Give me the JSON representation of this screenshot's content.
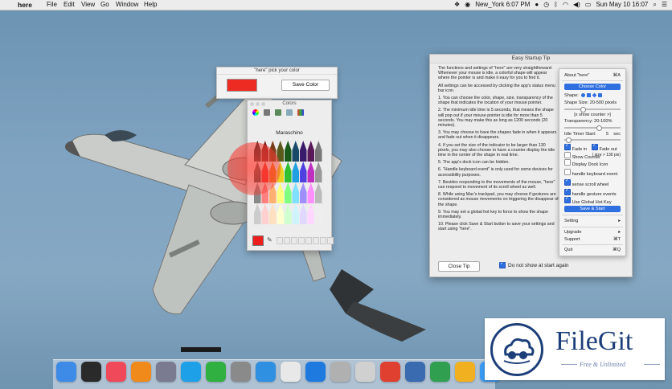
{
  "menubar": {
    "app_name": "here",
    "menus": [
      "File",
      "Edit",
      "View",
      "Go",
      "Window",
      "Help"
    ],
    "status": {
      "location_time": "New_York 6:07 PM",
      "datetime": "Sun May 10  16:07"
    }
  },
  "pick_window": {
    "title": "\"here\" pick your color",
    "save_label": "Save Color",
    "color": "#ee2b22"
  },
  "colors_panel": {
    "title": "Colors",
    "color_name": "Maraschino"
  },
  "tip_window": {
    "title": "Easy Startup Tip",
    "paragraphs": [
      "The functions and settings of \"here\" are very straightforward: Whenever your mouse is idle, a colorful shape will appear where the pointer is and make it easy for you to find it.",
      "All settings can be accessed by clicking the app's status menu bar icon.",
      "1.   You can choose the color, shape, size, transparency of the shape that indicates the location of your mouse pointer.",
      "2.   The minimum idle time is 5 seconds, that means the shape will pop out if your mouse pointer is idle for more than 5 seconds. You may make this as long as 1200 seconds (20 minutes).",
      "3.   You may choose to have the shapes fade in when it appears and fade out when it disappears.",
      "4.   If you set the size of the indicator to be larger than 130 pixels, you may also choose to have a counter display the idle time in the center of the shape in real time.",
      "5.   The app's dock icon can be hidden.",
      "6.   \"Handle keyboard event\" is only used for some devices for accessibility purposes.",
      "7.   Besides responding to the movements of the mouse, \"here\" can respond to movement of its scroll wheel as well.",
      "8.   While using Mac's trackpad, you may choose if gestures are considered as mouse movements on triggering the disappear of the shape.",
      "9.   You may set a global hot key to force to show the shape immediately.",
      "10.  Please click Save & Start button to save your settings and start using \"here\"."
    ],
    "close_label": "Close Tip",
    "dont_show_label": "Do not show at start again"
  },
  "status_menu": {
    "about_label": "About \"here\"",
    "about_shortcut": "⌘A",
    "choose_color_label": "Choose Color",
    "shape_label": "Shape:",
    "shape_size_label": "Shape Size: 20-500 pixels",
    "show_counter_hint": "[x show counter >]",
    "transparency_label": "Transparency: 20-100%",
    "idle_timer_label": "Idle Timer Start:",
    "idle_timer_value": "5",
    "idle_timer_unit": "sec",
    "fade_in_label": "Fade in",
    "fade_out_label": "Fade out",
    "show_counter_label": "Show Counter",
    "show_counter_note": "( size > 130 pix)",
    "dock_icon_label": "Display Dock Icon",
    "keyboard_label": "handle keyboard event",
    "scroll_label": "sense scroll wheel",
    "gesture_label": "handle gesture events",
    "hotkey_label": "Use Global Hot Key",
    "save_start_label": "Save & Start",
    "setting_label": "Setting",
    "upgrade_label": "Upgrade",
    "support_label": "Support",
    "support_shortcut": "⌘T",
    "quit_label": "Quit",
    "quit_shortcut": "⌘Q"
  },
  "dock": {
    "apps": [
      "finder-icon",
      "dashboard-icon",
      "itunes-icon",
      "ibooks-icon",
      "launchpad-icon",
      "skype-icon",
      "facetime-icon",
      "system-preferences-icon",
      "safari-icon",
      "chrome-icon",
      "app-store-icon",
      "disk-icon",
      "preview-icon",
      "rocket-icon",
      "xcode-icon",
      "numbers-icon",
      "sketch-icon",
      "messages-icon"
    ]
  },
  "watermark": {
    "brand": "FileGit",
    "tagline": "Free & Unlimited"
  }
}
